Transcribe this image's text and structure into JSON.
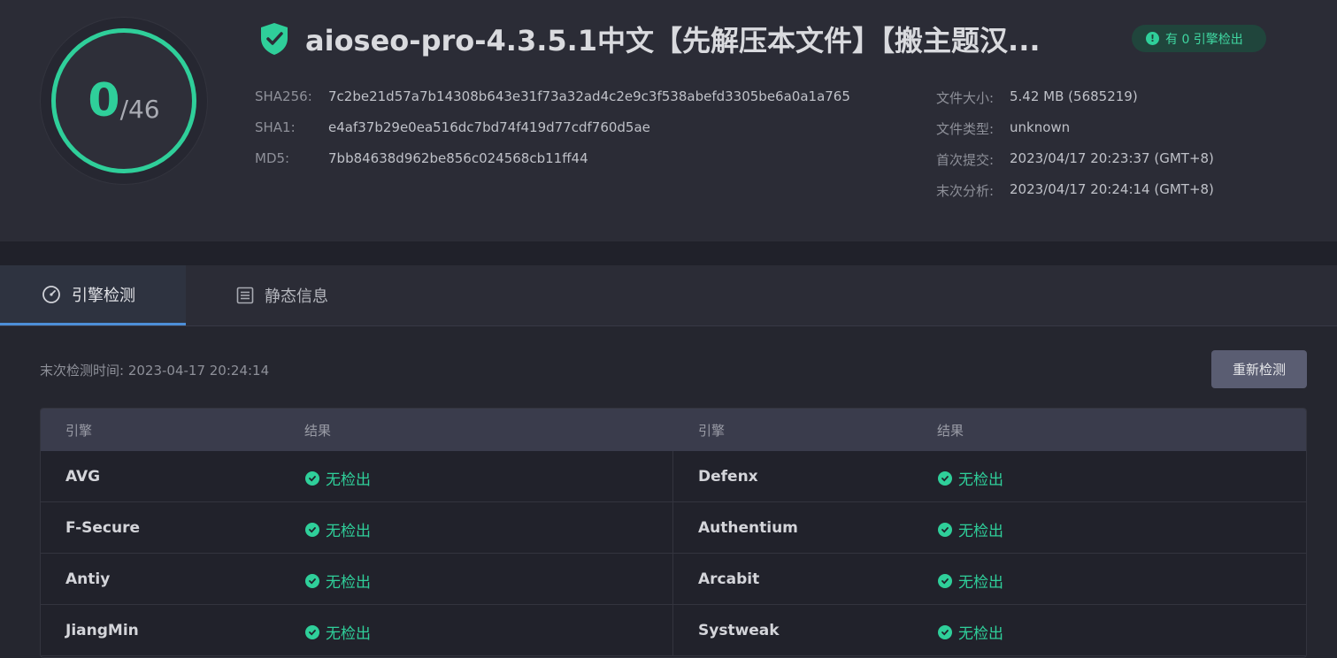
{
  "score": {
    "detected": "0",
    "total": "/46"
  },
  "file": {
    "title": "aioseo-pro-4.3.5.1中文【先解压本文件】【搬主题汉...",
    "badge": "有 0 引擎检出",
    "hashes": [
      {
        "key": "SHA256:",
        "value": "7c2be21d57a7b14308b643e31f73a32ad4c2e9c3f538abefd3305be6a0a1a765"
      },
      {
        "key": "SHA1:",
        "value": "e4af37b29e0ea516dc7bd74f419d77cdf760d5ae"
      },
      {
        "key": "MD5:",
        "value": "7bb84638d962be856c024568cb11ff44"
      }
    ],
    "meta": [
      {
        "key": "文件大小:",
        "value": "5.42 MB (5685219)"
      },
      {
        "key": "文件类型:",
        "value": "unknown"
      },
      {
        "key": "首次提交:",
        "value": "2023/04/17 20:23:37 (GMT+8)"
      },
      {
        "key": "末次分析:",
        "value": "2023/04/17 20:24:14 (GMT+8)"
      }
    ]
  },
  "tabs": [
    {
      "label": "引擎检测",
      "icon": "gauge-icon"
    },
    {
      "label": "静态信息",
      "icon": "list-icon"
    }
  ],
  "detection": {
    "last_time": "末次检测时间: 2023-04-17 20:24:14",
    "recheck_label": "重新检测",
    "headers": [
      "引擎",
      "结果",
      "引擎",
      "结果"
    ],
    "rows": [
      {
        "left_engine": "AVG",
        "left_result": "无检出",
        "right_engine": "Defenx",
        "right_result": "无检出"
      },
      {
        "left_engine": "F-Secure",
        "left_result": "无检出",
        "right_engine": "Authentium",
        "right_result": "无检出"
      },
      {
        "left_engine": "Antiy",
        "left_result": "无检出",
        "right_engine": "Arcabit",
        "right_result": "无检出"
      },
      {
        "left_engine": "JiangMin",
        "left_result": "无检出",
        "right_engine": "Systweak",
        "right_result": "无检出"
      }
    ]
  },
  "colors": {
    "accent": "#2fcf9a",
    "tab_underline": "#4d8fd8",
    "background": "#25262f"
  }
}
